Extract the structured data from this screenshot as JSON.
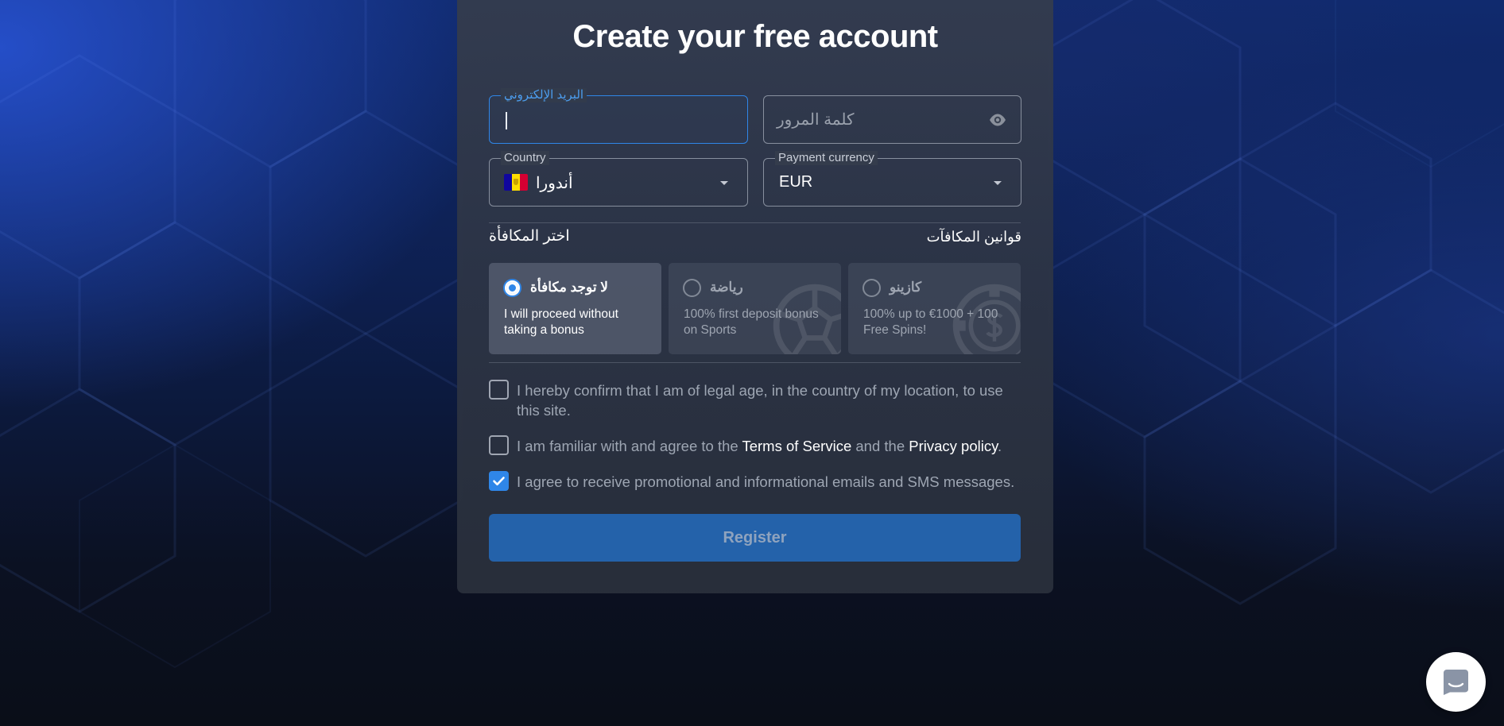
{
  "form": {
    "title": "Create your free account",
    "email": {
      "label": "البريد الإلكتروني",
      "value": ""
    },
    "password": {
      "placeholder": "كلمة المرور",
      "icon": "eye-icon"
    },
    "country": {
      "label": "Country",
      "value": "أندورا",
      "flag_colors": [
        "#10069f",
        "#fedd00",
        "#d50032"
      ]
    },
    "currency": {
      "label": "Payment currency",
      "value": "EUR"
    },
    "bonus": {
      "heading": "اختر المكافأة",
      "rules_link": "قوانين المكافآت",
      "options": [
        {
          "title": "لا توجد مكافأة",
          "description": "I will proceed without taking a bonus",
          "selected": true
        },
        {
          "title": "رياضة",
          "description": "100% first deposit bonus on Sports",
          "selected": false,
          "icon": "football-icon"
        },
        {
          "title": "كازينو",
          "description": "100% up to €1000 + 100 Free Spins!",
          "selected": false,
          "icon": "casino-chip-icon"
        }
      ]
    },
    "agreements": {
      "legal_age": {
        "text": "I hereby confirm that I am of legal age, in the country of my location, to use this site.",
        "checked": false
      },
      "terms": {
        "text_before": "I am familiar with and agree to the ",
        "terms_link": "Terms of Service",
        "text_middle": " and the ",
        "privacy_link": "Privacy policy",
        "text_after": ".",
        "checked": false
      },
      "promo": {
        "text": "I agree to receive promotional and informational emails and SMS messages.",
        "checked": true
      }
    },
    "register_label": "Register"
  },
  "colors": {
    "accent": "#2f86e8",
    "register_bg": "#2462aa",
    "card_bg": "#343c4c"
  },
  "chat_widget": {
    "icon": "chat-icon"
  }
}
